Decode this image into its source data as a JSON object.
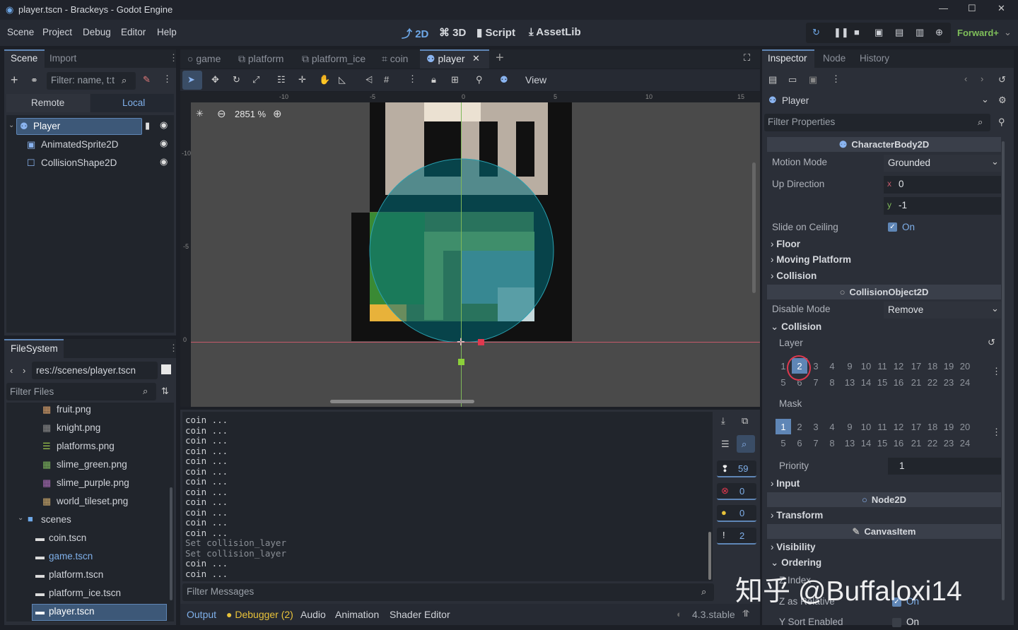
{
  "window": {
    "title": "player.tscn - Brackeys - Godot Engine"
  },
  "menu": [
    "Scene",
    "Project",
    "Debug",
    "Editor",
    "Help"
  ],
  "workspaces": [
    "2D",
    "3D",
    "Script",
    "AssetLib"
  ],
  "renderer": "Forward+",
  "scene_dock": {
    "tabs": [
      "Scene",
      "Import"
    ],
    "filter_placeholder": "Filter: name, t:t",
    "remote": "Remote",
    "local": "Local",
    "nodes": [
      "Player",
      "AnimatedSprite2D",
      "CollisionShape2D"
    ]
  },
  "filesystem": {
    "tab": "FileSystem",
    "path": "res://scenes/player.tscn",
    "filter_placeholder": "Filter Files",
    "items": [
      "fruit.png",
      "knight.png",
      "platforms.png",
      "slime_green.png",
      "slime_purple.png",
      "world_tileset.png",
      "scenes",
      "coin.tscn",
      "game.tscn",
      "platform.tscn",
      "platform_ice.tscn",
      "player.tscn"
    ]
  },
  "scene_tabs": [
    "game",
    "platform",
    "platform_ice",
    "coin",
    "player"
  ],
  "viewport": {
    "zoom": "2851 %",
    "view_label": "View",
    "ruler_marks": [
      "-10",
      "-5",
      "0",
      "5",
      "10",
      "15"
    ],
    "vruler_marks": [
      "-10",
      "-5",
      "0"
    ]
  },
  "output": {
    "lines": [
      "coin ...",
      "coin ...",
      "coin ...",
      "coin ...",
      "coin ...",
      "coin ...",
      "coin ...",
      "coin ...",
      "coin ...",
      "coin ...",
      "coin ...",
      "coin ...",
      "Set collision_layer",
      "Set collision_layer",
      "coin ...",
      "coin ..."
    ],
    "filter_placeholder": "Filter Messages",
    "counters": [
      "59",
      "0",
      "0",
      "2"
    ]
  },
  "bottom_tabs": [
    "Output",
    "Debugger (2)",
    "Audio",
    "Animation",
    "Shader Editor"
  ],
  "version": "4.3.stable",
  "inspector": {
    "tabs": [
      "Inspector",
      "Node",
      "History"
    ],
    "node": "Player",
    "filter_placeholder": "Filter Properties",
    "class1": "CharacterBody2D",
    "motion_mode_label": "Motion Mode",
    "motion_mode": "Grounded",
    "up_direction_label": "Up Direction",
    "up_x": "0",
    "up_y": "-1",
    "slide_label": "Slide on Ceiling",
    "slide_val": "On",
    "floor": "Floor",
    "moving_platform": "Moving Platform",
    "collision_group": "Collision",
    "class2": "CollisionObject2D",
    "disable_mode_label": "Disable Mode",
    "disable_mode": "Remove",
    "collision": "Collision",
    "layer": "Layer",
    "mask": "Mask",
    "priority_label": "Priority",
    "priority": "1",
    "input": "Input",
    "class3": "Node2D",
    "transform": "Transform",
    "class4": "CanvasItem",
    "visibility": "Visibility",
    "ordering": "Ordering",
    "z_index_label": "Z Index",
    "z_relative_label": "Z as Relative",
    "z_relative_val": "On",
    "ysort_label": "Y Sort Enabled",
    "ysort_val": "On",
    "layer_row1": [
      "1",
      "2",
      "3",
      "4",
      "9",
      "10",
      "11",
      "12",
      "17",
      "18",
      "19",
      "20"
    ],
    "layer_row2": [
      "5",
      "6",
      "7",
      "8",
      "13",
      "14",
      "15",
      "16",
      "21",
      "22",
      "23",
      "24"
    ]
  },
  "watermark": "知乎 @Buffaloxi14",
  "colors": {
    "accent": "#5f86b6",
    "panel": "#2b2f38",
    "bg": "#1c1f26"
  }
}
